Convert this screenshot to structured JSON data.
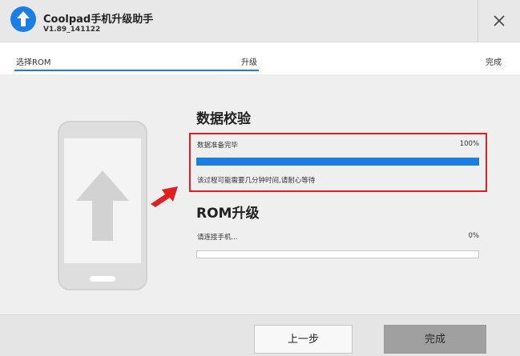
{
  "window": {
    "title": "Coolpad手机升级助手",
    "version": "V1.89_141122"
  },
  "steps": [
    {
      "label": "选择ROM"
    },
    {
      "label": "升级"
    },
    {
      "label": "完成"
    }
  ],
  "sections": {
    "data_check": {
      "title": "数据校验",
      "status": "数据准备完毕",
      "percent_text": "100%",
      "progress": 1.0,
      "note": "该过程可能需要几分钟时间,请耐心等待"
    },
    "rom_upgrade": {
      "title": "ROM升级",
      "status": "请连接手机...",
      "percent_text": "0%",
      "progress": 0.0
    }
  },
  "buttons": {
    "prev": "上一步",
    "done": "完成"
  },
  "colors": {
    "accent": "#1a7ee6",
    "highlight_border": "#e02020",
    "pointer_arrow": "#e02020",
    "disabled_button": "#a0a0a0"
  },
  "icons": {
    "logo": "upload-arrow-circle-icon",
    "close": "close-icon",
    "illustration": "phone-upgrade-illustration",
    "pointer": "red-pointer-arrow-icon"
  }
}
